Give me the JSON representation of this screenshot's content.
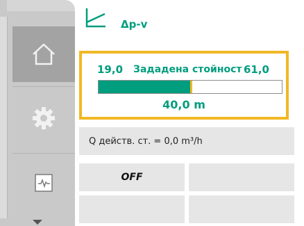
{
  "header": {
    "mode_icon": "dp-v-curve-icon",
    "mode_label": "Δp-v"
  },
  "nav": {
    "items": [
      {
        "icon": "home-icon",
        "active": true
      },
      {
        "icon": "gear-icon",
        "active": false
      },
      {
        "icon": "diagnostics-icon",
        "active": false
      }
    ],
    "scroll_indicator_icon": "chevron-down-icon"
  },
  "setpoint": {
    "min": "19,0",
    "title": "Зададена стойност",
    "max": "61,0",
    "value_text": "40,0 m",
    "min_value": 19.0,
    "max_value": 61.0,
    "current_value": 40.0
  },
  "info": {
    "flow_text": "Q действ. ст. = 0,0 m³/h"
  },
  "status": {
    "off_label": "OFF"
  },
  "colors": {
    "accent": "#009d7e",
    "highlight": "#f2b824",
    "rail": "#c9c9c9",
    "rail_active": "#a3a3a3",
    "tile": "#e6e6e6"
  }
}
